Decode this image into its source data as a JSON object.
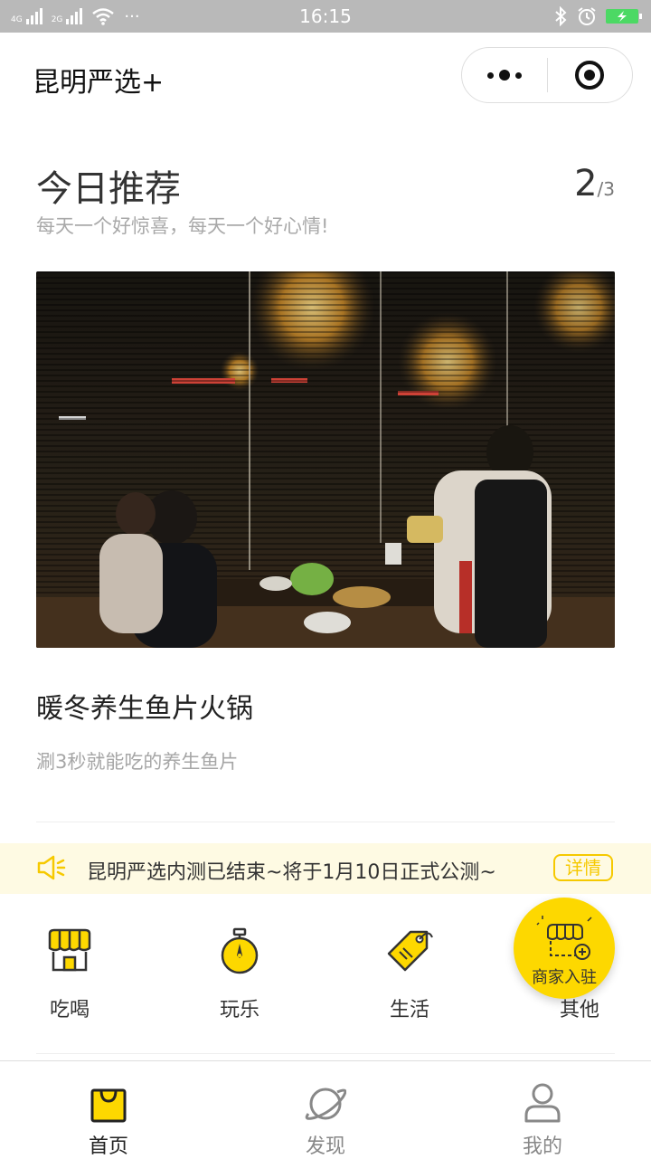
{
  "statusbar": {
    "signal1": "4G",
    "signal2": "2G",
    "more": "···",
    "time": "16:15"
  },
  "app": {
    "title": "昆明严选+"
  },
  "recommend": {
    "title": "今日推荐",
    "subtitle": "每天一个好惊喜，每天一个好心情!",
    "current": "2",
    "total": "/3"
  },
  "card": {
    "title": "暖冬养生鱼片火锅",
    "desc": "涮3秒就能吃的养生鱼片"
  },
  "notice": {
    "text": "昆明严选内测已结束~将于1月10日正式公测~",
    "button": "详情"
  },
  "categories": [
    {
      "label": "吃喝",
      "icon": "food-stall-icon"
    },
    {
      "label": "玩乐",
      "icon": "stopwatch-icon"
    },
    {
      "label": "生活",
      "icon": "price-tag-icon"
    },
    {
      "label": "其他",
      "icon": "other-icon"
    }
  ],
  "fab": {
    "label": "商家入驻",
    "icon": "shop-plus-icon"
  },
  "tabs": [
    {
      "label": "首页",
      "icon": "shopping-bag-icon",
      "active": true
    },
    {
      "label": "发现",
      "icon": "planet-icon",
      "active": false
    },
    {
      "label": "我的",
      "icon": "user-icon",
      "active": false
    }
  ],
  "colors": {
    "accent": "#fdd800",
    "notice_bg": "#fefae3",
    "detail_border": "#f6c900",
    "statusbar_bg": "#b9b9b9"
  }
}
